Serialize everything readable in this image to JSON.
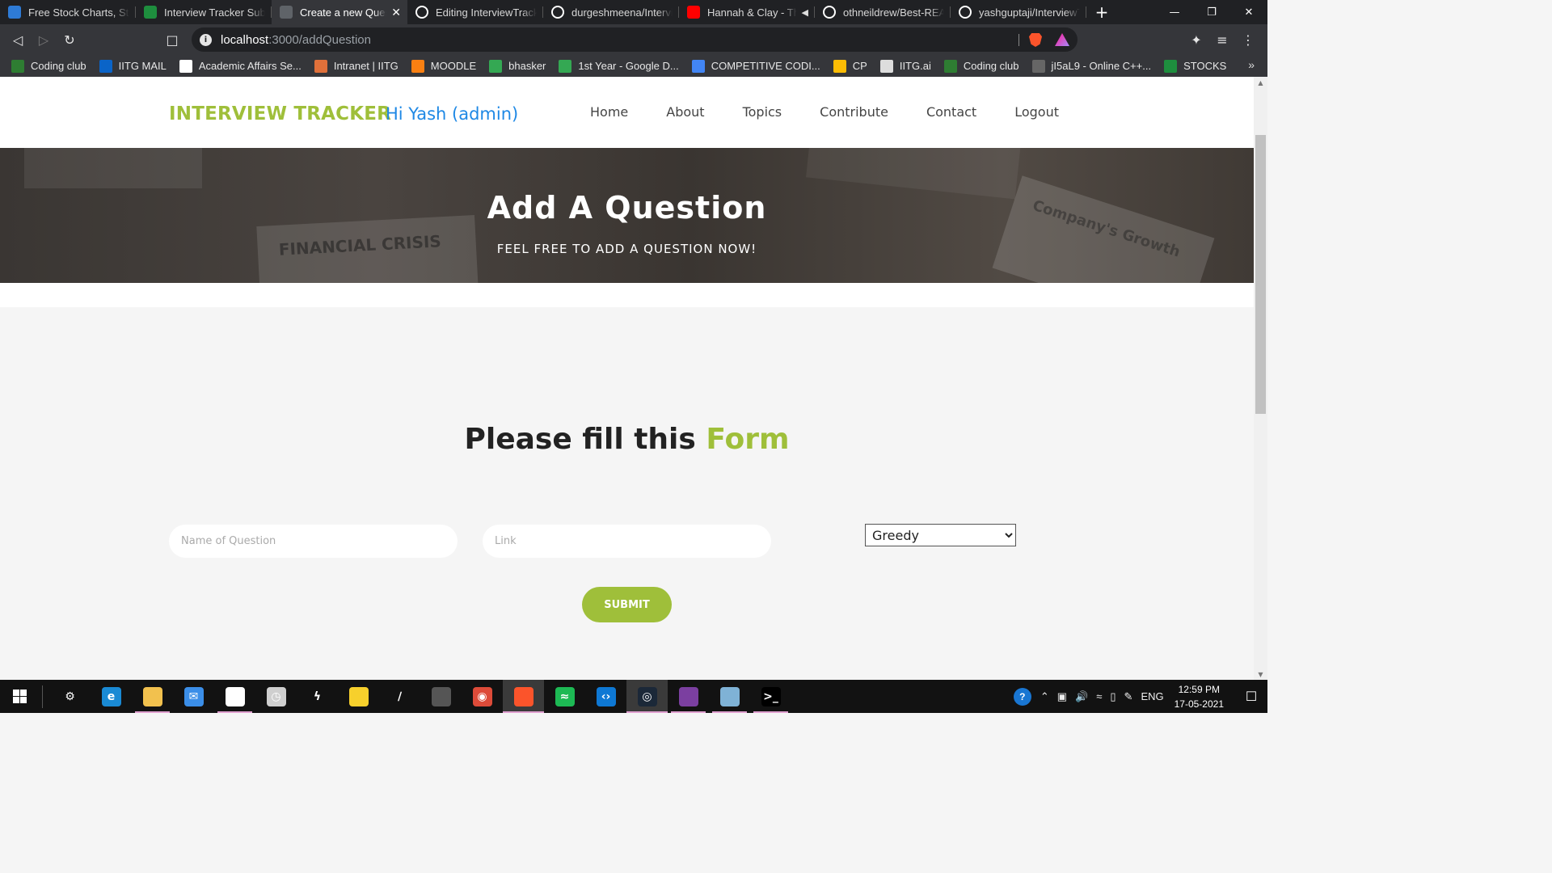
{
  "browser": {
    "tabs": [
      {
        "title": "Free Stock Charts, Stock",
        "icon": "chart-icon",
        "color": "#2e7bd6",
        "active": false
      },
      {
        "title": "Interview Tracker Submi",
        "icon": "sheets-icon",
        "color": "#1e8e3e",
        "active": false
      },
      {
        "title": "Create a new Questi",
        "icon": "globe-icon",
        "color": "#5f6368",
        "active": true
      },
      {
        "title": "Editing InterviewTracker",
        "icon": "github-icon",
        "color": "#ffffff",
        "active": false
      },
      {
        "title": "durgeshmeena/Intervie",
        "icon": "github-icon",
        "color": "#ffffff",
        "active": false
      },
      {
        "title": "Hannah & Clay - The",
        "icon": "youtube-icon",
        "color": "#ff0000",
        "active": false
      },
      {
        "title": "othneildrew/Best-READ",
        "icon": "github-icon",
        "color": "#ffffff",
        "active": false
      },
      {
        "title": "yashguptaji/InterviewTra",
        "icon": "github-icon",
        "color": "#ffffff",
        "active": false
      }
    ],
    "url_host": "localhost",
    "url_rest": ":3000/addQuestion",
    "bookmarks": [
      {
        "label": "Coding club",
        "color": "#2e7d32"
      },
      {
        "label": "IITG MAIL",
        "color": "#0a64c8"
      },
      {
        "label": "Academic Affairs Se...",
        "color": "#ffffff"
      },
      {
        "label": "Intranet | IITG",
        "color": "#e0703a"
      },
      {
        "label": "MOODLE",
        "color": "#f98012"
      },
      {
        "label": "bhasker",
        "color": "#34a853"
      },
      {
        "label": "1st Year - Google D...",
        "color": "#34a853"
      },
      {
        "label": "COMPETITIVE CODI...",
        "color": "#4285f4"
      },
      {
        "label": "CP",
        "color": "#fbbc04"
      },
      {
        "label": "IITG.ai",
        "color": "#dddddd"
      },
      {
        "label": "Coding club",
        "color": "#2e7d32"
      },
      {
        "label": "jI5aL9 - Online C++...",
        "color": "#666666"
      },
      {
        "label": "STOCKS",
        "color": "#1e8e3e"
      }
    ]
  },
  "site": {
    "brand": "INTERVIEW TRACKER",
    "greeting": "Hi Yash (admin)",
    "nav": [
      "Home",
      "About",
      "Topics",
      "Contribute",
      "Contact",
      "Logout"
    ],
    "hero_title": "Add A Question",
    "hero_subtitle": "FEEL FREE TO ADD A QUESTION NOW!",
    "hero_deco_left": "FINANCIAL CRISIS",
    "hero_deco_right": "Company's Growth",
    "form_title_prefix": "Please fill this ",
    "form_title_accent": "Form",
    "name_placeholder": "Name of Question",
    "link_placeholder": "Link",
    "topic_selected": "Greedy",
    "submit_label": "SUBMIT",
    "accent_color": "#9fbf3a",
    "greeting_color": "#1e88e5"
  },
  "taskbar": {
    "apps": [
      "settings-icon",
      "edge-icon",
      "file-explorer-icon",
      "mail-icon",
      "store-icon",
      "clock-app-icon",
      "vs-icon",
      "sticky-notes-icon",
      "app-red-icon",
      "app-gray-icon",
      "chrome-icon",
      "brave-icon",
      "spotify-icon",
      "vscode-icon",
      "steam-icon",
      "winrar-icon",
      "app-blue-icon",
      "terminal-icon"
    ],
    "language": "ENG",
    "time": "12:59 PM",
    "date": "17-05-2021"
  }
}
